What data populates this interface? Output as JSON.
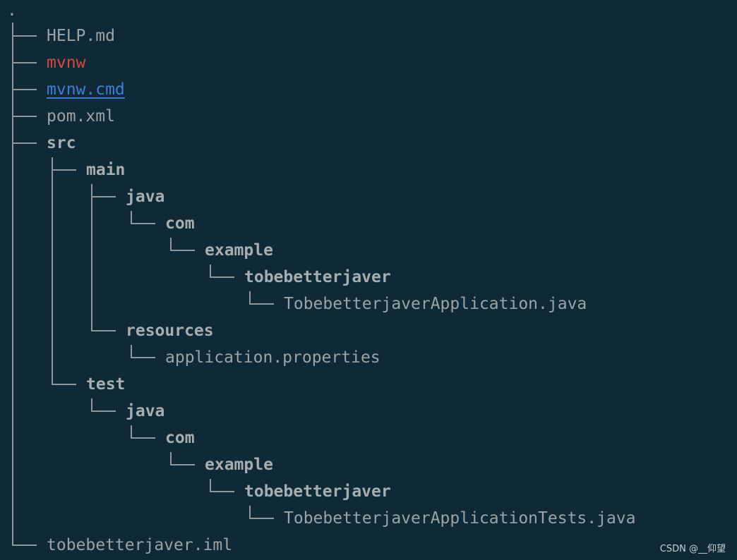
{
  "tree": {
    "root": ".",
    "nodes": [
      {
        "id": "help-md",
        "label": "HELP.md",
        "type": "file"
      },
      {
        "id": "mvnw",
        "label": "mvnw",
        "type": "exec"
      },
      {
        "id": "mvnw-cmd",
        "label": "mvnw.cmd",
        "type": "link"
      },
      {
        "id": "pom-xml",
        "label": "pom.xml",
        "type": "file"
      },
      {
        "id": "src",
        "label": "src",
        "type": "dir"
      },
      {
        "id": "main",
        "label": "main",
        "type": "dir"
      },
      {
        "id": "main-java",
        "label": "java",
        "type": "dir"
      },
      {
        "id": "main-com",
        "label": "com",
        "type": "dir"
      },
      {
        "id": "main-example",
        "label": "example",
        "type": "dir"
      },
      {
        "id": "main-pkg",
        "label": "tobebetterjaver",
        "type": "dir"
      },
      {
        "id": "main-app",
        "label": "TobebetterjaverApplication.java",
        "type": "file"
      },
      {
        "id": "resources",
        "label": "resources",
        "type": "dir"
      },
      {
        "id": "app-props",
        "label": "application.properties",
        "type": "file"
      },
      {
        "id": "test",
        "label": "test",
        "type": "dir"
      },
      {
        "id": "test-java",
        "label": "java",
        "type": "dir"
      },
      {
        "id": "test-com",
        "label": "com",
        "type": "dir"
      },
      {
        "id": "test-example",
        "label": "example",
        "type": "dir"
      },
      {
        "id": "test-pkg",
        "label": "tobebetterjaver",
        "type": "dir"
      },
      {
        "id": "test-app",
        "label": "TobebetterjaverApplicationTests.java",
        "type": "file"
      },
      {
        "id": "iml",
        "label": "tobebetterjaver.iml",
        "type": "file"
      }
    ]
  },
  "watermark": "CSDN @__仰望",
  "colors": {
    "background": "#0f2a36",
    "file": "#9aa3a6",
    "dir": "#a5aeb1",
    "exec": "#d44a3f",
    "link": "#3f7ed6",
    "line": "#8f999c"
  }
}
